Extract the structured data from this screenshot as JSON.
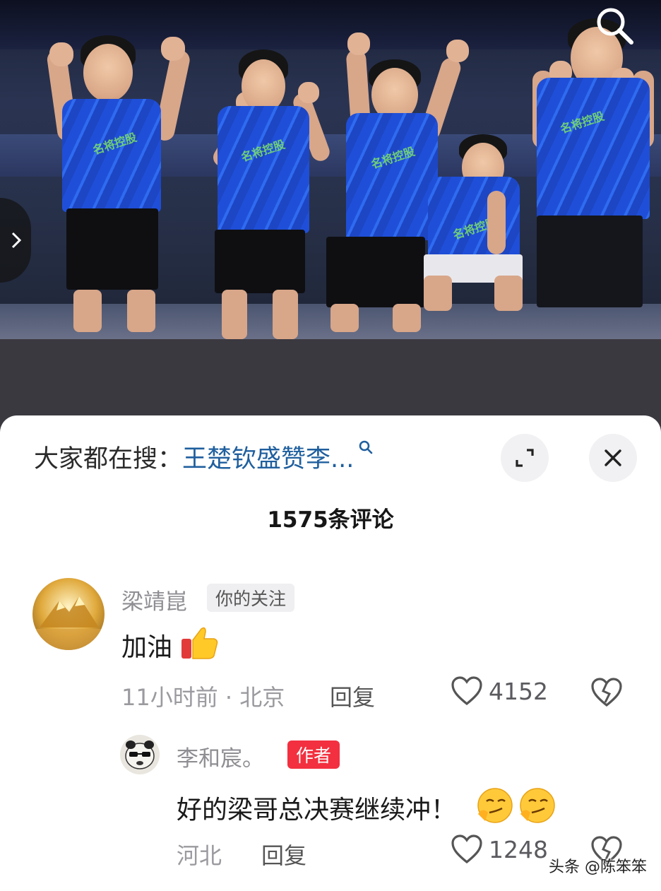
{
  "video": {
    "search_icon": "search-icon",
    "prev_icon": "chevron-right-icon",
    "jersey_text": "名将控股"
  },
  "sheet": {
    "search_prefix": "大家都在搜：",
    "search_term": "王楚钦盛赞李...",
    "expand_icon": "expand-icon",
    "close_icon": "close-icon",
    "comment_count": "1575条评论"
  },
  "comments": [
    {
      "username": "梁靖崑",
      "tag": "你的关注",
      "text": "加油",
      "time_location": "11小时前 · 北京",
      "reply_label": "回复",
      "likes": "4152"
    }
  ],
  "replies": [
    {
      "username": "李和宸。",
      "tag": "作者",
      "text": "好的梁哥总决赛继续冲！",
      "location": "河北",
      "reply_label": "回复",
      "likes": "1248"
    }
  ],
  "watermark": "头条 @陈笨笨",
  "colors": {
    "link": "#1f5f9e",
    "author_tag": "#f2303f",
    "jersey_blue": "#1f4fd8"
  }
}
